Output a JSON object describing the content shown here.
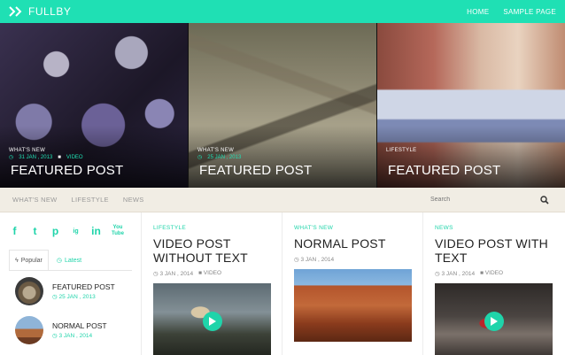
{
  "brand": {
    "name": "FULLBY"
  },
  "topnav": {
    "items": [
      "HOME",
      "SAMPLE PAGE"
    ]
  },
  "featured": [
    {
      "category": "WHAT'S NEW",
      "date": "31 JAN , 2013",
      "type": "VIDEO",
      "title": "FEATURED POST"
    },
    {
      "category": "WHAT'S NEW",
      "date": "25 JAN , 2013",
      "title": "FEATURED POST"
    },
    {
      "category": "LIFESTYLE",
      "date": "",
      "title": "FEATURED POST"
    }
  ],
  "subnav": {
    "items": [
      "WHAT'S NEW",
      "LIFESTYLE",
      "NEWS"
    ],
    "search_placeholder": "Search"
  },
  "sidebar": {
    "social": [
      "f",
      "t",
      "p",
      "ig",
      "in",
      "You Tube"
    ],
    "tabs": [
      "Popular",
      "Latest"
    ],
    "posts": [
      {
        "title": "FEATURED POST",
        "date": "25 JAN , 2013"
      },
      {
        "title": "NORMAL POST",
        "date": "3 JAN , 2014"
      }
    ]
  },
  "posts": [
    {
      "category": "LIFESTYLE",
      "title": "VIDEO POST WITHOUT TEXT",
      "date": "3 JAN , 2014",
      "type": "VIDEO"
    },
    {
      "category": "WHAT'S NEW",
      "title": "NORMAL POST",
      "date": "3 JAN , 2014",
      "type": ""
    },
    {
      "category": "NEWS",
      "title": "VIDEO POST WITH TEXT",
      "date": "3 JAN , 2014",
      "type": "VIDEO"
    }
  ],
  "colors": {
    "accent": "#1fe0b4",
    "subnav_bg": "#f1ede4"
  }
}
